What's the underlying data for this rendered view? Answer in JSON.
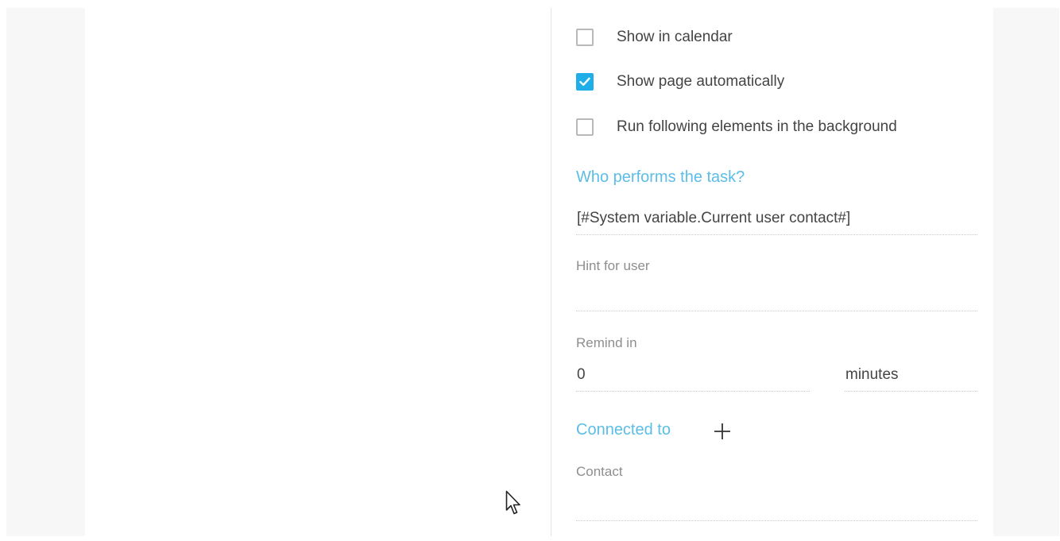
{
  "checkboxes": [
    {
      "label": "Show in calendar",
      "checked": false
    },
    {
      "label": "Show page automatically",
      "checked": true
    },
    {
      "label": "Run following elements in the background",
      "checked": false
    }
  ],
  "performer": {
    "title": "Who performs the task?",
    "value": "[#System variable.Current user contact#]"
  },
  "hint": {
    "label": "Hint for user",
    "value": ""
  },
  "remind": {
    "label": "Remind in",
    "value": "0",
    "unit": "minutes"
  },
  "connected": {
    "title": "Connected to",
    "add_icon": "plus-icon"
  },
  "contact": {
    "label": "Contact",
    "value": ""
  },
  "colors": {
    "accent": "#1faee8",
    "section_title": "#5cbde6",
    "text": "#444444",
    "label": "#8e8e8e"
  },
  "icons": {
    "checkmark": "check-icon",
    "cursor": "mouse-pointer-icon"
  }
}
